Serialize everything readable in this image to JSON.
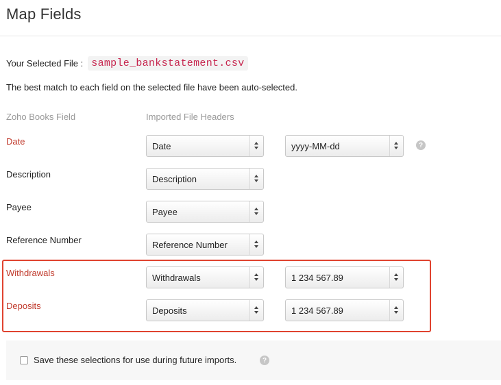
{
  "page": {
    "title": "Map Fields",
    "selected_file_label": "Your Selected File :",
    "selected_file_name": "sample_bankstatement.csv",
    "description": "The best match to each field on the selected file have been auto-selected."
  },
  "columns": {
    "zoho_field": "Zoho Books Field",
    "imported_headers": "Imported File Headers"
  },
  "fields": [
    {
      "label": "Date",
      "required": true,
      "header": "Date",
      "format": "yyyy-MM-dd"
    },
    {
      "label": "Description",
      "required": false,
      "header": "Description"
    },
    {
      "label": "Payee",
      "required": false,
      "header": "Payee"
    },
    {
      "label": "Reference Number",
      "required": false,
      "header": "Reference Number"
    },
    {
      "label": "Withdrawals",
      "required": true,
      "header": "Withdrawals",
      "format": "1 234 567.89"
    },
    {
      "label": "Deposits",
      "required": true,
      "header": "Deposits",
      "format": "1 234 567.89"
    }
  ],
  "footer": {
    "save_selections_label": "Save these selections for use during future imports.",
    "checked": false
  },
  "icons": {
    "help": "?"
  },
  "colors": {
    "required_label": "#c0392b",
    "highlight_border": "#e0432f",
    "file_name": "#c7254e"
  }
}
